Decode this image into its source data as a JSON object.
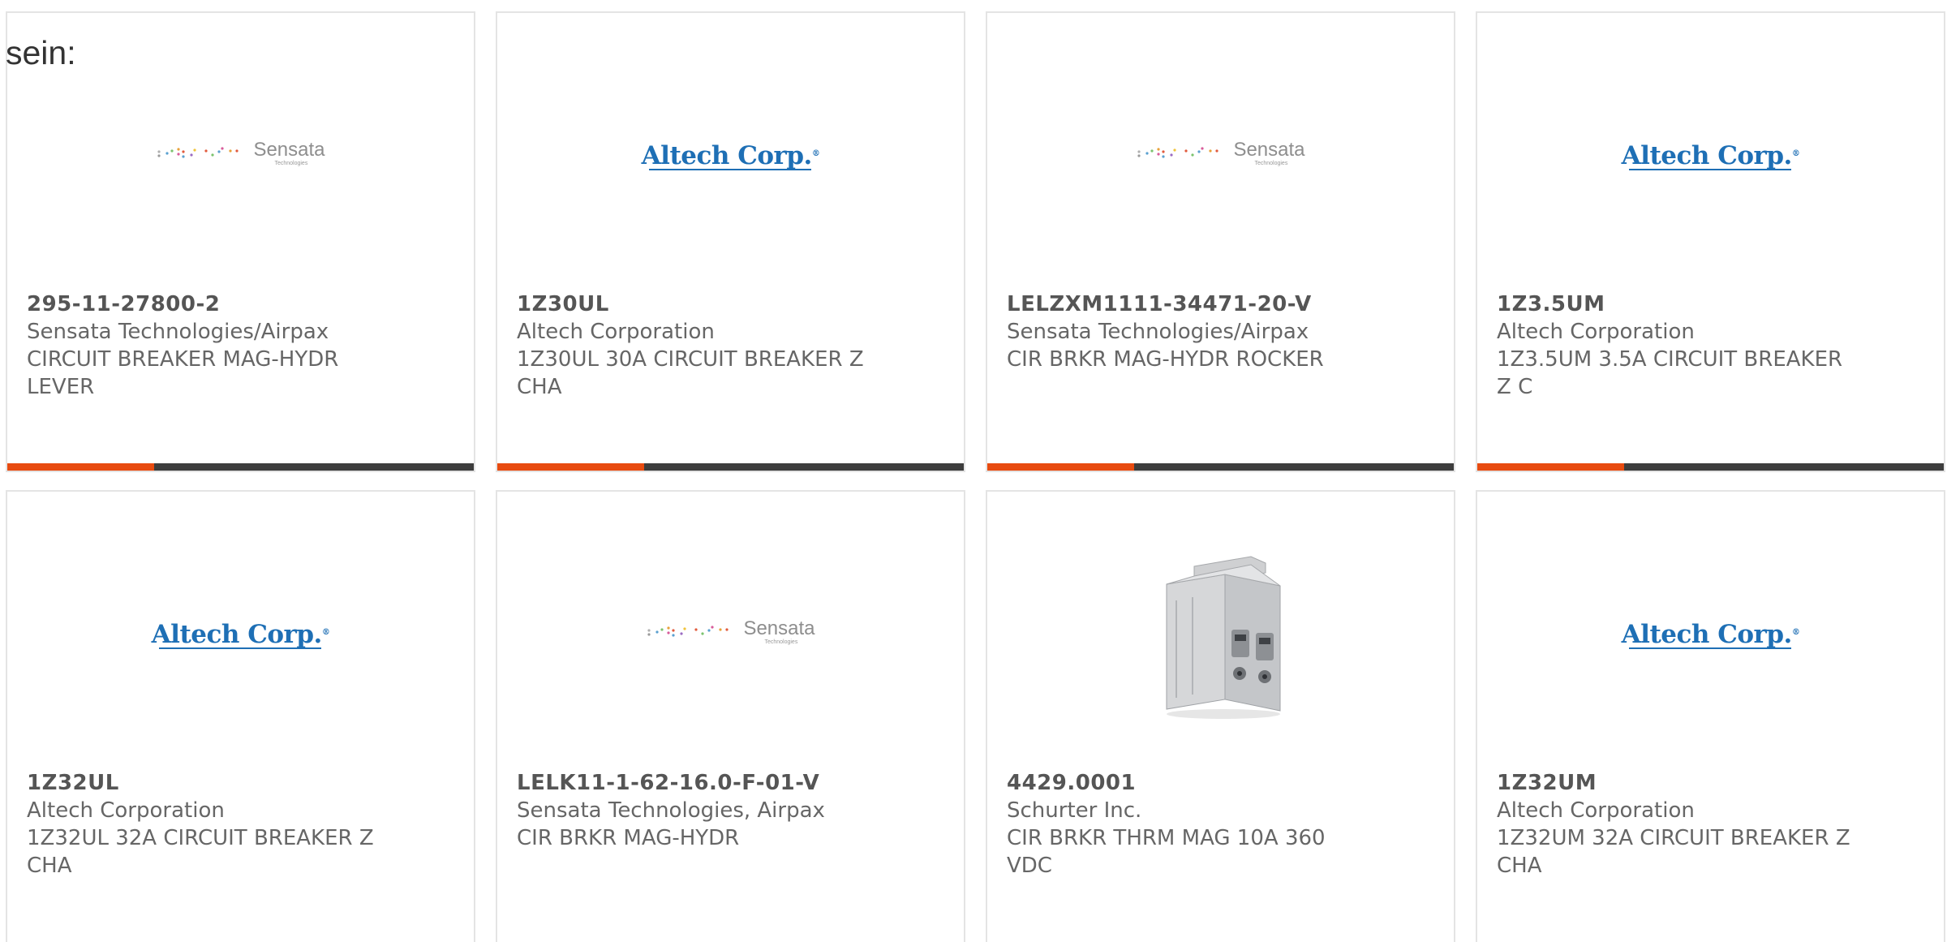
{
  "intro_text": "sein:",
  "products": [
    {
      "part_number": "295-11-27800-2",
      "manufacturer": "Sensata Technologies/Airpax",
      "description": "CIRCUIT BREAKER MAG-HYDR LEVER",
      "logo": {
        "name": "Sensata",
        "subtitle": "Technologies"
      }
    },
    {
      "part_number": "1Z30UL",
      "manufacturer": "Altech Corporation",
      "description": "1Z30UL 30A CIRCUIT BREAKER Z CHA",
      "logo": {
        "name": "Altech Corp."
      }
    },
    {
      "part_number": "LELZXM1111-34471-20-V",
      "manufacturer": "Sensata Technologies/Airpax",
      "description": "CIR BRKR MAG-HYDR ROCKER",
      "logo": {
        "name": "Sensata",
        "subtitle": "Technologies"
      }
    },
    {
      "part_number": "1Z3.5UM",
      "manufacturer": "Altech Corporation",
      "description": "1Z3.5UM 3.5A CIRCUIT BREAKER Z C",
      "logo": {
        "name": "Altech Corp."
      }
    },
    {
      "part_number": "1Z32UL",
      "manufacturer": "Altech Corporation",
      "description": "1Z32UL 32A CIRCUIT BREAKER Z CHA",
      "logo": {
        "name": "Altech Corp."
      }
    },
    {
      "part_number": "LELK11-1-62-16.0-F-01-V",
      "manufacturer": "Sensata Technologies, Airpax",
      "description": "CIR BRKR MAG-HYDR",
      "logo": {
        "name": "Sensata",
        "subtitle": "Technologies"
      }
    },
    {
      "part_number": "4429.0001",
      "manufacturer": "Schurter Inc.",
      "description": "CIR BRKR THRM MAG 10A 360 VDC",
      "image": "circuit-breaker-photo"
    },
    {
      "part_number": "1Z32UM",
      "manufacturer": "Altech Corporation",
      "description": "1Z32UM 32A CIRCUIT BREAKER Z CHA",
      "logo": {
        "name": "Altech Corp."
      }
    }
  ],
  "colors": {
    "accent": "#e84b10",
    "bar": "#3d3d3d",
    "altech_blue": "#1e6fb5",
    "text": "#666666"
  }
}
